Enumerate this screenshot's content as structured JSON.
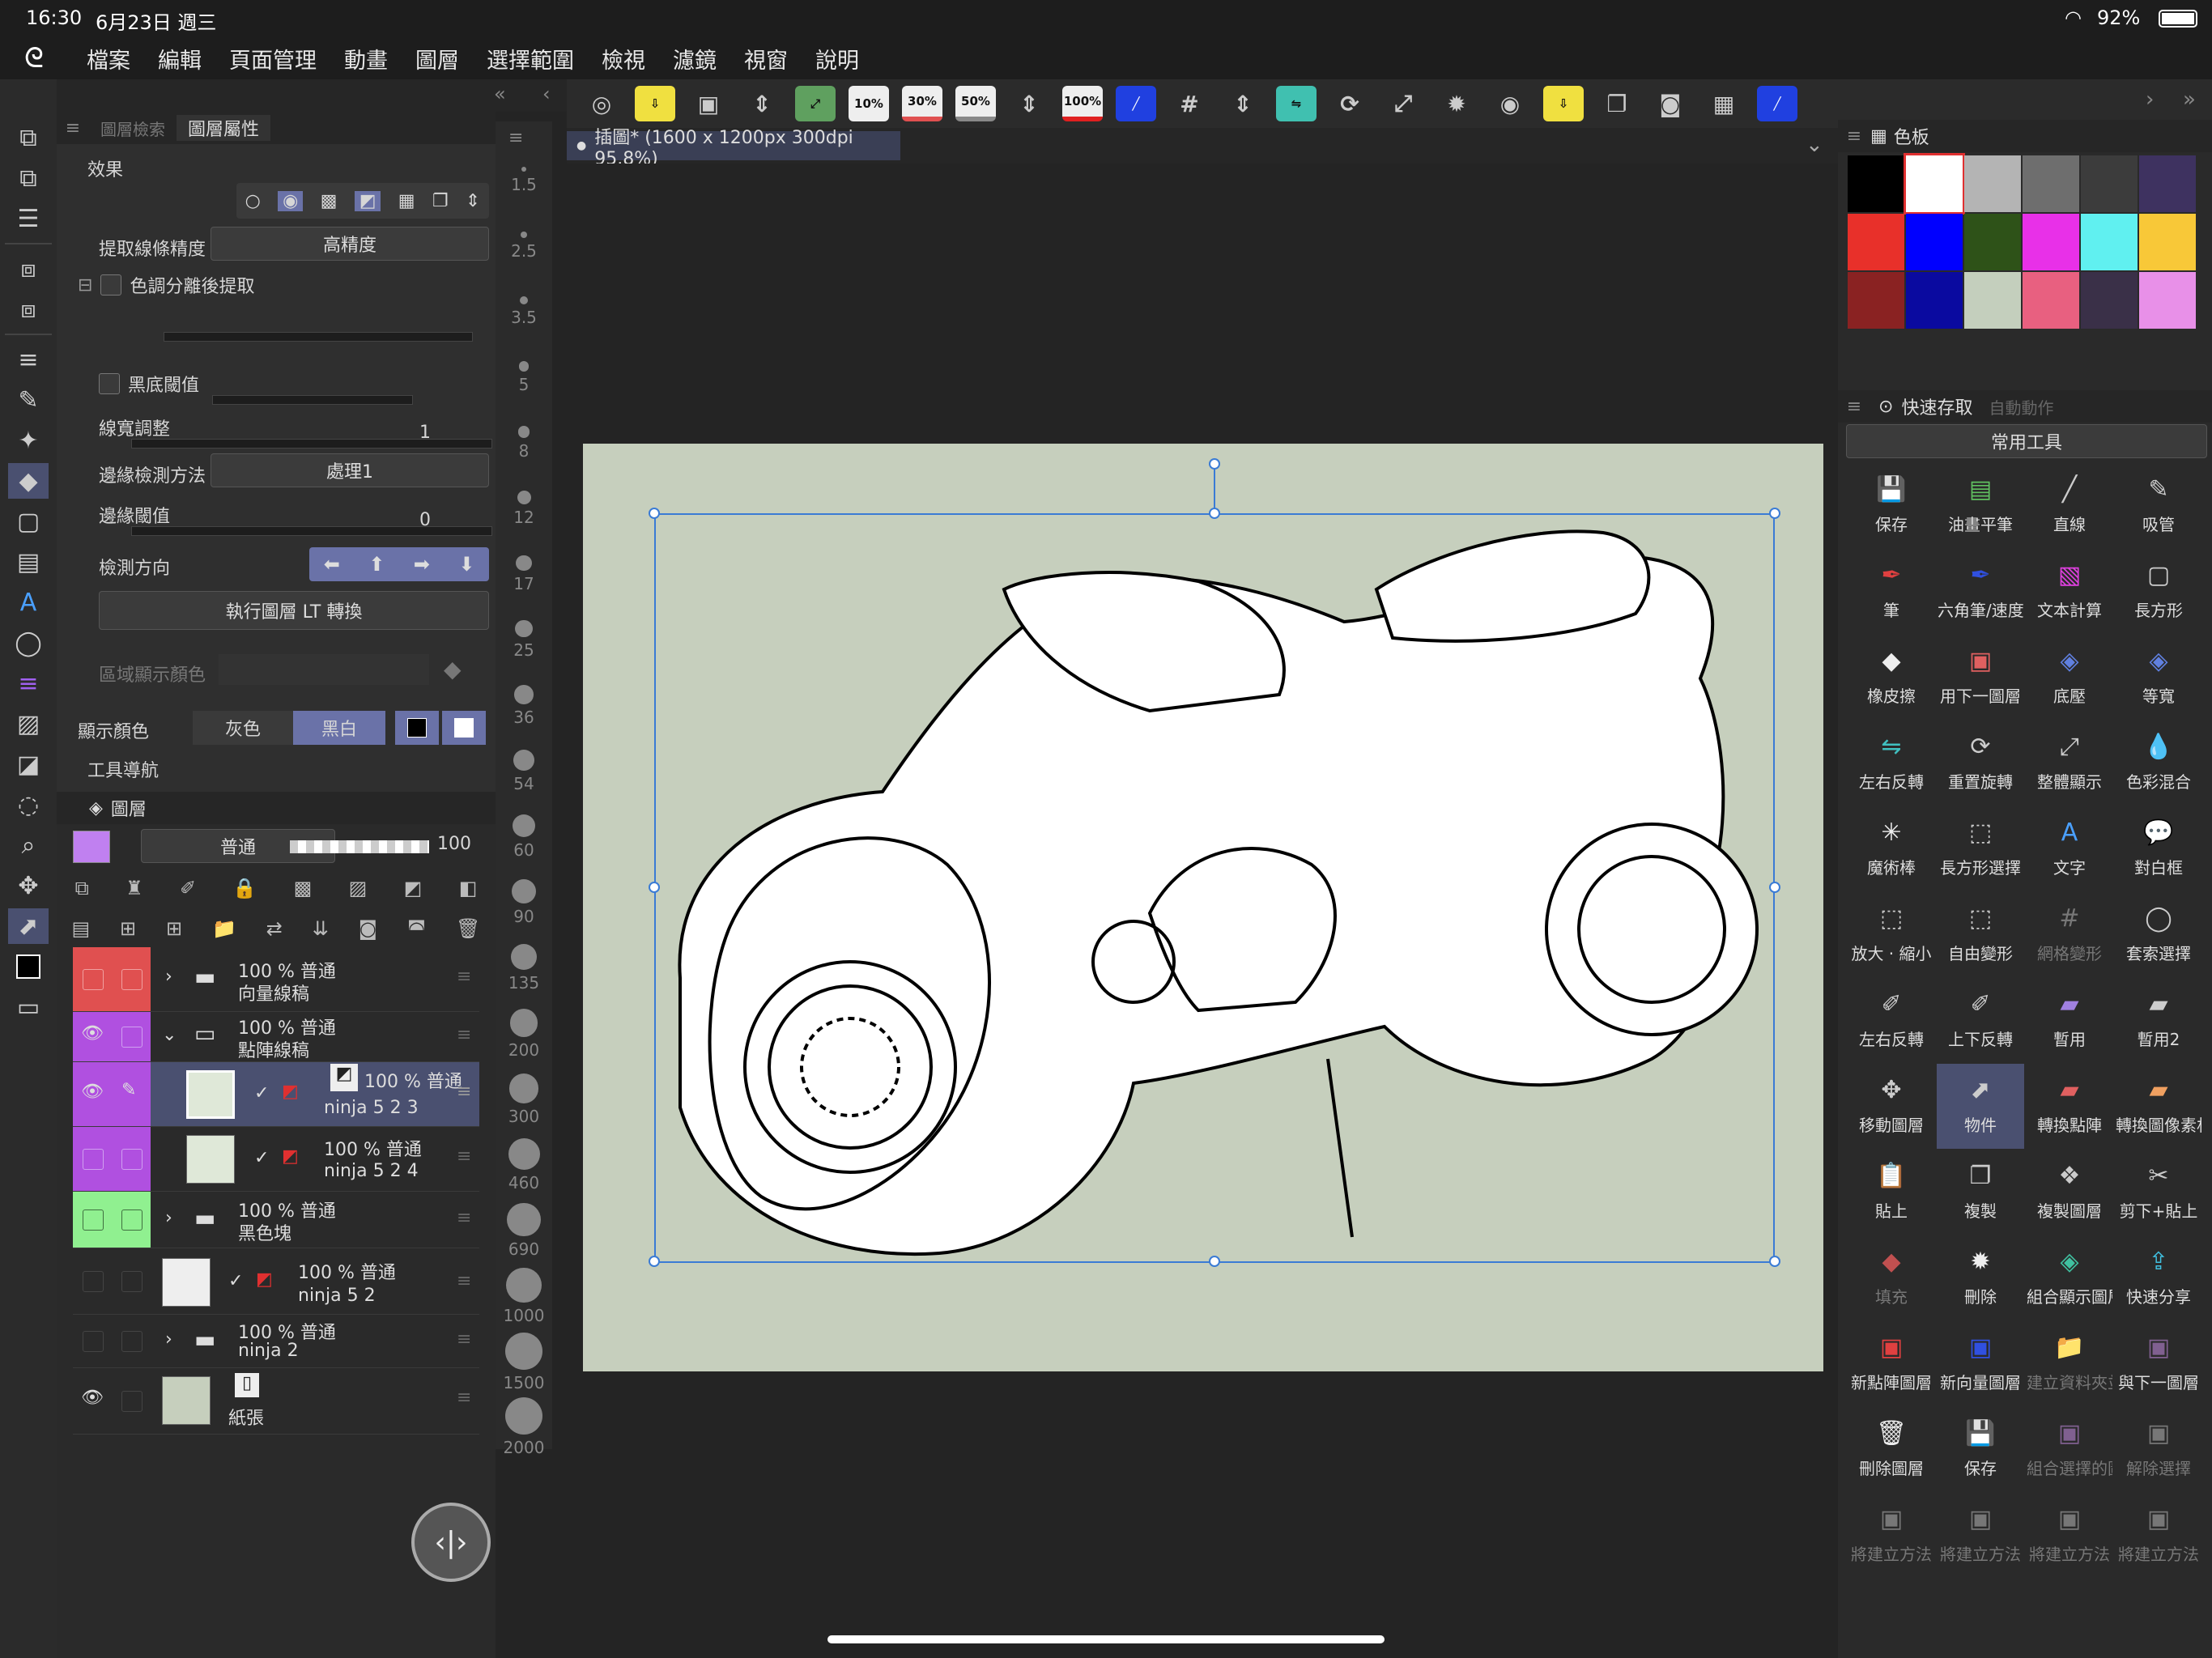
{
  "status": {
    "time": "16:30",
    "date": "6月23日 週三",
    "battery": "92%"
  },
  "menu": [
    "檔案",
    "編輯",
    "頁面管理",
    "動畫",
    "圖層",
    "選擇範圍",
    "檢視",
    "濾鏡",
    "視窗",
    "說明"
  ],
  "toolbar": {
    "zoom_buttons": [
      "10%",
      "30%",
      "50%",
      "100%"
    ]
  },
  "property_panel": {
    "tabs": [
      "圖層檢索",
      "圖層屬性"
    ],
    "section_effect": "效果",
    "extract_precision_label": "提取線條精度",
    "extract_precision_value": "高精度",
    "tone_extract_label": "色調分離後提取",
    "black_threshold_label": "黑底閾值",
    "line_width_label": "線寬調整",
    "line_width_value": "1",
    "edge_method_label": "邊緣檢測方法",
    "edge_method_value": "處理1",
    "edge_threshold_label": "邊緣閾值",
    "edge_threshold_value": "0",
    "direction_label": "檢測方向",
    "execute_button": "執行圖層 LT 轉換",
    "area_color_label": "區域顯示顏色",
    "display_color_label": "顯示顏色",
    "gray_label": "灰色",
    "bw_label": "黑白",
    "tool_nav_label": "工具導航"
  },
  "layers_panel": {
    "title": "圖層",
    "blend_mode": "普通",
    "opacity": "100",
    "rows": [
      {
        "line1": "100 % 普通",
        "line2": "向量線稿"
      },
      {
        "line1": "100 % 普通",
        "line2": "點陣線稿"
      },
      {
        "line1": "100 % 普通",
        "line2": "ninja 5 2 3"
      },
      {
        "line1": "100 % 普通",
        "line2": "ninja 5 2 4"
      },
      {
        "line1": "100 % 普通",
        "line2": "黑色塊"
      },
      {
        "line1": "100 % 普通",
        "line2": "ninja 5 2"
      },
      {
        "line1": "100 % 普通",
        "line2": "ninja 2"
      },
      {
        "line1": "",
        "line2": "紙張"
      }
    ]
  },
  "brush_sizes": [
    "1.5",
    "2.5",
    "3.5",
    "5",
    "8",
    "12",
    "17",
    "25",
    "36",
    "54",
    "60",
    "90",
    "135",
    "200",
    "300",
    "460",
    "690",
    "1000",
    "1500",
    "2000"
  ],
  "document": {
    "tab_title": "插圖* (1600 x 1200px 300dpi 95.8%)"
  },
  "color_panel": {
    "title": "色板",
    "colors": [
      "#000000",
      "#ffffff",
      "#b4b4b4",
      "#6e6e6e",
      "#3c3c3c",
      "#3e3260",
      "#e8302a",
      "#0000ff",
      "#2e5218",
      "#e830e8",
      "#60f0f0",
      "#f8c838",
      "#8a2222",
      "#0a0aa0",
      "#c4cfbd",
      "#e86080",
      "#3a3048",
      "#e890e8"
    ]
  },
  "quick_access": {
    "tabs": [
      "快速存取",
      "自動動作"
    ],
    "set": "常用工具",
    "items": [
      {
        "label": "保存",
        "icon": "💾"
      },
      {
        "label": "油畫平筆",
        "icon": "▤"
      },
      {
        "label": "直線",
        "icon": "╱"
      },
      {
        "label": "吸管",
        "icon": "✎"
      },
      {
        "label": "筆",
        "icon": "✒"
      },
      {
        "label": "六角筆/速度",
        "icon": "✒"
      },
      {
        "label": "文本計算",
        "icon": "▧"
      },
      {
        "label": "長方形",
        "icon": "▢"
      },
      {
        "label": "橡皮擦",
        "icon": "◆"
      },
      {
        "label": "用下一圖層",
        "icon": "▣"
      },
      {
        "label": "底壓",
        "icon": "◈"
      },
      {
        "label": "等寬",
        "icon": "◈"
      },
      {
        "label": "左右反轉",
        "icon": "⇋"
      },
      {
        "label": "重置旋轉",
        "icon": "⟳"
      },
      {
        "label": "整體顯示",
        "icon": "⤢"
      },
      {
        "label": "色彩混合",
        "icon": "💧"
      },
      {
        "label": "魔術棒",
        "icon": "✳"
      },
      {
        "label": "長方形選擇",
        "icon": "⬚"
      },
      {
        "label": "文字",
        "icon": "A"
      },
      {
        "label": "對白框",
        "icon": "💬"
      },
      {
        "label": "放大 · 縮小",
        "icon": "⬚"
      },
      {
        "label": "自由變形",
        "icon": "⬚"
      },
      {
        "label": "網格變形",
        "icon": "#"
      },
      {
        "label": "套索選擇",
        "icon": "◯"
      },
      {
        "label": "左右反轉",
        "icon": "✐"
      },
      {
        "label": "上下反轉",
        "icon": "✐"
      },
      {
        "label": "暫用",
        "icon": "▰"
      },
      {
        "label": "暫用2",
        "icon": "▰"
      },
      {
        "label": "移動圖層",
        "icon": "✥"
      },
      {
        "label": "物件",
        "icon": "⬈"
      },
      {
        "label": "轉換點陣",
        "icon": "▰"
      },
      {
        "label": "轉換圖像素材",
        "icon": "▰"
      },
      {
        "label": "貼上",
        "icon": "📋"
      },
      {
        "label": "複製",
        "icon": "❐"
      },
      {
        "label": "複製圖層",
        "icon": "❖"
      },
      {
        "label": "剪下+貼上",
        "icon": "✂"
      },
      {
        "label": "填充",
        "icon": "◆"
      },
      {
        "label": "刪除",
        "icon": "✹"
      },
      {
        "label": "組合顯示圖層",
        "icon": "◈"
      },
      {
        "label": "快速分享",
        "icon": "⇪"
      },
      {
        "label": "新點陣圖層",
        "icon": "▣"
      },
      {
        "label": "新向量圖層",
        "icon": "▣"
      },
      {
        "label": "建立資料夾並",
        "icon": "📁"
      },
      {
        "label": "與下一圖層",
        "icon": "▣"
      },
      {
        "label": "刪除圖層",
        "icon": "🗑"
      },
      {
        "label": "保存",
        "icon": "💾"
      },
      {
        "label": "組合選擇的圖",
        "icon": "▣"
      },
      {
        "label": "解除選擇",
        "icon": "▣"
      },
      {
        "label": "將建立方法",
        "icon": "▣"
      },
      {
        "label": "將建立方法",
        "icon": "▣"
      },
      {
        "label": "將建立方法",
        "icon": "▣"
      },
      {
        "label": "將建立方法",
        "icon": "▣"
      }
    ]
  }
}
